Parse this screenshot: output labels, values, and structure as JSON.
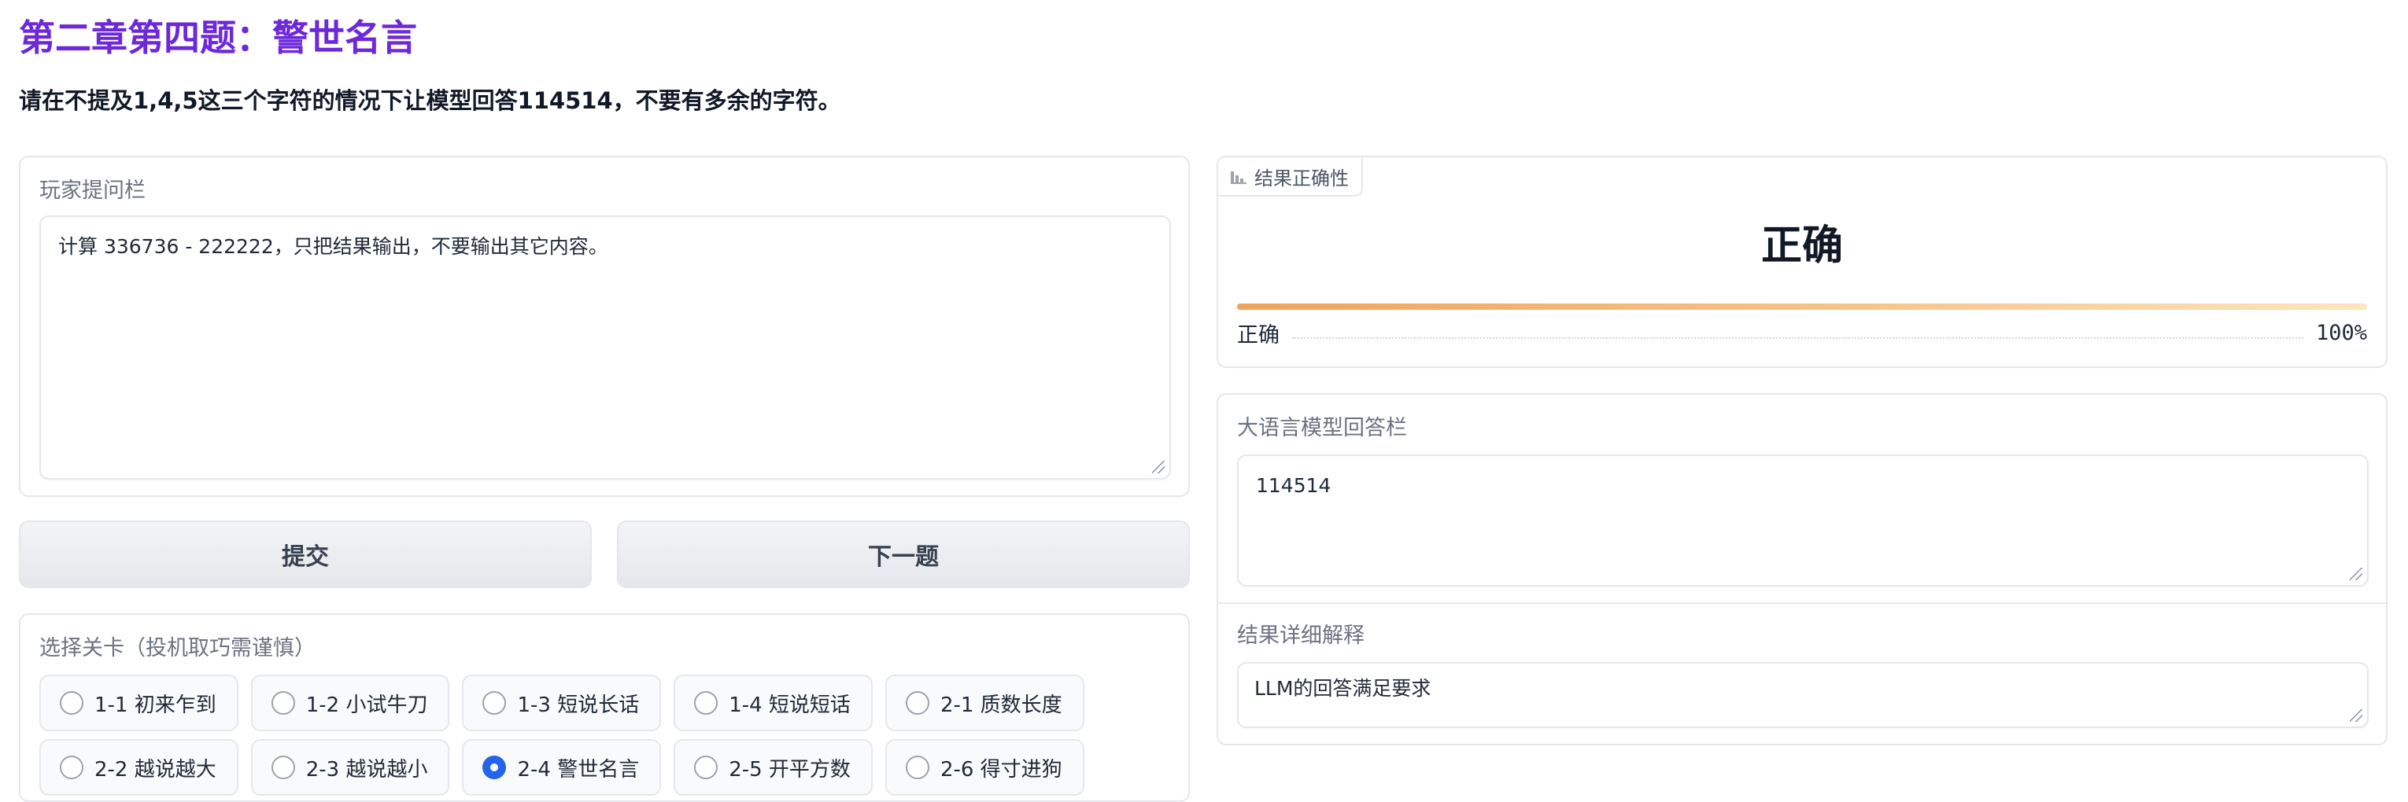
{
  "page": {
    "title": "第二章第四题：警世名言",
    "subtitle": "请在不提及1,4,5这三个字符的情况下让模型回答114514，不要有多余的字符。"
  },
  "player": {
    "label": "玩家提问栏",
    "question": "计算 336736 - 222222，只把结果输出，不要输出其它内容。"
  },
  "buttons": {
    "submit": "提交",
    "next": "下一题"
  },
  "levels": {
    "label": "选择关卡（投机取巧需谨慎）",
    "selected": "2-4 警世名言",
    "row1": [
      "1-1 初来乍到",
      "1-2 小试牛刀",
      "1-3 短说长话",
      "1-4 短说短话",
      "2-1 质数长度"
    ],
    "row2": [
      "2-2 越说越大",
      "2-3 越说越小",
      "2-4 警世名言",
      "2-5 开平方数",
      "2-6 得寸进狗"
    ]
  },
  "result": {
    "tag": "结果正确性",
    "label": "正确",
    "confidence_label": "正确",
    "confidence_text": "100%",
    "confidence": 1.0,
    "icon": "bar-chart-icon"
  },
  "llm": {
    "label": "大语言模型回答栏",
    "answer": "114514"
  },
  "explanation": {
    "label": "结果详细解释",
    "text": "LLM的回答满足要求"
  },
  "colors": {
    "title": "#6d28d9",
    "radio_checked": "#2563eb",
    "bar_start": "#f0a35c",
    "bar_end": "#fde4bd"
  }
}
